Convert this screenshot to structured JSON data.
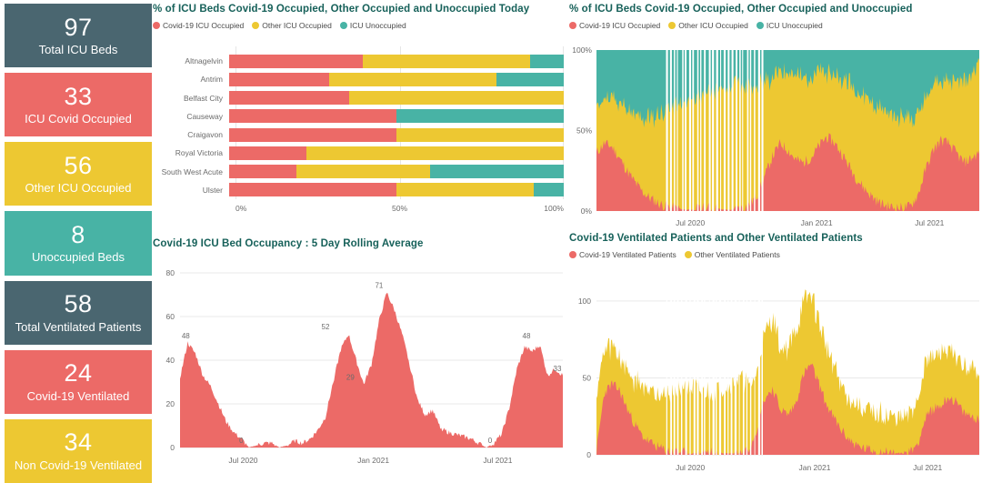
{
  "colors": {
    "covid_red": "#ec6a67",
    "other_yellow": "#edc832",
    "unoccupied_teal": "#48b3a5",
    "slate": "#4a6670",
    "title": "#17615a",
    "axis_text": "#6b6b6b",
    "grid": "#e9e9e9"
  },
  "kpis": [
    {
      "value": "97",
      "label": "Total ICU Beds",
      "color": "#4a6670"
    },
    {
      "value": "33",
      "label": "ICU Covid Occupied",
      "color": "#ec6a67"
    },
    {
      "value": "56",
      "label": "Other ICU Occupied",
      "color": "#edc832"
    },
    {
      "value": "8",
      "label": "Unoccupied Beds",
      "color": "#48b3a5"
    },
    {
      "value": "58",
      "label": "Total Ventilated Patients",
      "color": "#4a6670"
    },
    {
      "value": "24",
      "label": "Covid-19 Ventilated",
      "color": "#ec6a67"
    },
    {
      "value": "34",
      "label": "Non Covid-19 Ventilated",
      "color": "#edc832"
    }
  ],
  "panel_hospital": {
    "title": "% of ICU Beds Covid-19 Occupied, Other Occupied and Unoccupied Today",
    "legend": [
      {
        "label": "Covid-19 ICU Occupied",
        "color": "#ec6a67"
      },
      {
        "label": "Other ICU Occupied",
        "color": "#edc832"
      },
      {
        "label": "ICU Unoccupied",
        "color": "#48b3a5"
      }
    ]
  },
  "panel_pct_trend": {
    "title": "% of ICU Beds Covid-19 Occupied, Other Occupied and Unoccupied",
    "legend": [
      {
        "label": "Covid-19 ICU Occupied",
        "color": "#ec6a67"
      },
      {
        "label": "Other ICU Occupied",
        "color": "#edc832"
      },
      {
        "label": "ICU Unoccupied",
        "color": "#48b3a5"
      }
    ]
  },
  "panel_rolling": {
    "title": "Covid-19 ICU Bed Occupancy : 5 Day Rolling Average"
  },
  "panel_vent": {
    "title": "Covid-19 Ventilated Patients and Other Ventilated Patients",
    "legend": [
      {
        "label": "Covid-19 Ventilated Patients",
        "color": "#ec6a67"
      },
      {
        "label": "Other Ventilated Patients",
        "color": "#edc832"
      }
    ]
  },
  "chart_data": [
    {
      "id": "hospital_stacked",
      "type": "bar",
      "orientation": "horizontal",
      "stacked": true,
      "title": "% of ICU Beds Covid-19 Occupied, Other Occupied and Unoccupied Today",
      "xlabel": "",
      "ylabel": "",
      "xlim": [
        0,
        100
      ],
      "xticks": [
        0,
        50,
        100
      ],
      "xticklabels": [
        "0%",
        "50%",
        "100%"
      ],
      "grid": true,
      "legend_position": "top-left",
      "categories": [
        "Altnagelvin",
        "Antrim",
        "Belfast City",
        "Causeway",
        "Craigavon",
        "Royal Victoria",
        "South West Acute",
        "Ulster"
      ],
      "series": [
        {
          "name": "Covid-19 ICU Occupied",
          "color": "#ec6a67",
          "values": [
            40,
            30,
            36,
            50,
            50,
            23,
            20,
            50
          ]
        },
        {
          "name": "Other ICU Occupied",
          "color": "#edc832",
          "values": [
            50,
            50,
            64,
            0,
            50,
            77,
            40,
            41
          ]
        },
        {
          "name": "ICU Unoccupied",
          "color": "#48b3a5",
          "values": [
            10,
            20,
            0,
            50,
            0,
            0,
            40,
            9
          ]
        }
      ]
    },
    {
      "id": "pct_trend",
      "type": "area",
      "stacked": true,
      "normalized": true,
      "title": "% of ICU Beds Covid-19 Occupied, Other Occupied and Unoccupied",
      "xlabel": "",
      "ylabel": "",
      "ylim": [
        0,
        100
      ],
      "yticks": [
        0,
        50,
        100
      ],
      "yticklabels": [
        "0%",
        "50%",
        "100%"
      ],
      "xticklabels": [
        "Jul 2020",
        "Jan 2021",
        "Jul 2021"
      ],
      "xtick_positions_pct": [
        24.5,
        57.5,
        87.0
      ],
      "grid": false,
      "legend_position": "top-left",
      "series": [
        {
          "name": "Covid-19 ICU Occupied",
          "color": "#ec6a67"
        },
        {
          "name": "Other ICU Occupied",
          "color": "#edc832"
        },
        {
          "name": "ICU Unoccupied",
          "color": "#48b3a5"
        }
      ],
      "x_sample_pct": [
        0,
        2,
        4,
        6,
        8,
        10,
        12,
        14,
        16,
        18,
        20,
        22,
        24,
        26,
        28,
        30,
        32,
        34,
        36,
        38,
        40,
        42,
        44,
        46,
        48,
        50,
        52,
        54,
        56,
        58,
        60,
        62,
        64,
        66,
        68,
        70,
        72,
        74,
        76,
        78,
        80,
        82,
        84,
        86,
        88,
        90,
        92,
        94,
        96,
        98,
        100
      ],
      "covid_pct": [
        36,
        42,
        40,
        33,
        25,
        18,
        12,
        8,
        5,
        3,
        2,
        1,
        1,
        1,
        2,
        2,
        1,
        1,
        1,
        2,
        4,
        10,
        22,
        34,
        42,
        38,
        32,
        30,
        33,
        40,
        46,
        43,
        36,
        28,
        20,
        14,
        9,
        5,
        3,
        2,
        2,
        3,
        10,
        26,
        38,
        44,
        42,
        36,
        30,
        33,
        36
      ],
      "other_pct": [
        27,
        25,
        30,
        33,
        38,
        42,
        45,
        50,
        55,
        58,
        62,
        66,
        68,
        70,
        70,
        72,
        74,
        76,
        78,
        76,
        74,
        68,
        58,
        50,
        45,
        48,
        52,
        54,
        50,
        45,
        40,
        42,
        47,
        52,
        56,
        58,
        58,
        60,
        58,
        56,
        55,
        54,
        50,
        44,
        40,
        36,
        38,
        44,
        50,
        52,
        56
      ],
      "unoccupied_pct": [
        37,
        33,
        30,
        34,
        37,
        40,
        43,
        42,
        40,
        39,
        36,
        33,
        31,
        29,
        28,
        26,
        25,
        23,
        21,
        22,
        22,
        22,
        20,
        16,
        13,
        14,
        16,
        16,
        17,
        15,
        14,
        15,
        17,
        20,
        24,
        28,
        33,
        35,
        39,
        42,
        43,
        43,
        40,
        30,
        22,
        20,
        20,
        20,
        20,
        15,
        8
      ],
      "white_gap_zone_pct": [
        18,
        44
      ]
    },
    {
      "id": "icu_rolling_avg",
      "type": "area",
      "title": "Covid-19 ICU Bed Occupancy : 5 Day Rolling Average",
      "xlabel": "",
      "ylabel": "",
      "ylim": [
        0,
        80
      ],
      "yticks": [
        0,
        20,
        40,
        60,
        80
      ],
      "yticklabels": [
        "0",
        "20",
        "40",
        "60",
        "80"
      ],
      "xticklabels": [
        "Jul 2020",
        "Jan 2021",
        "Jul 2021"
      ],
      "xtick_positions_pct": [
        16.5,
        50.5,
        83.0
      ],
      "grid": true,
      "color": "#ec6a67",
      "annotations": [
        {
          "label": "48",
          "x_pct": 1.5,
          "value": 48
        },
        {
          "label": "0",
          "x_pct": 16.0,
          "value": 0
        },
        {
          "label": "52",
          "x_pct": 38.0,
          "value": 52
        },
        {
          "label": "29",
          "x_pct": 44.5,
          "value": 29
        },
        {
          "label": "71",
          "x_pct": 52.0,
          "value": 71
        },
        {
          "label": "0",
          "x_pct": 81.0,
          "value": 0
        },
        {
          "label": "48",
          "x_pct": 90.5,
          "value": 48
        },
        {
          "label": "33",
          "x_pct": 99.0,
          "value": 33
        }
      ],
      "x_sample_pct": [
        0,
        2,
        4,
        6,
        8,
        10,
        12,
        14,
        16,
        18,
        20,
        22,
        24,
        26,
        28,
        30,
        32,
        34,
        36,
        38,
        40,
        42,
        44,
        46,
        48,
        50,
        52,
        54,
        56,
        58,
        60,
        62,
        64,
        66,
        68,
        70,
        72,
        74,
        76,
        78,
        80,
        82,
        84,
        86,
        88,
        90,
        92,
        94,
        96,
        98,
        100
      ],
      "values": [
        32,
        48,
        43,
        33,
        28,
        20,
        12,
        7,
        4,
        0,
        1,
        2,
        2,
        0,
        1,
        3,
        2,
        4,
        8,
        14,
        30,
        45,
        52,
        40,
        29,
        38,
        58,
        71,
        63,
        52,
        38,
        22,
        15,
        17,
        9,
        7,
        6,
        5,
        4,
        2,
        0,
        2,
        6,
        18,
        36,
        46,
        44,
        47,
        33,
        36,
        33
      ]
    },
    {
      "id": "ventilated",
      "type": "area",
      "stacked": true,
      "title": "Covid-19 Ventilated Patients and Other Ventilated Patients",
      "xlabel": "",
      "ylabel": "",
      "ylim": [
        0,
        110
      ],
      "yticks": [
        0,
        50,
        100
      ],
      "yticklabels": [
        "0",
        "50",
        "100"
      ],
      "xticklabels": [
        "Jul 2020",
        "Jan 2021",
        "Jul 2021"
      ],
      "xtick_positions_pct": [
        24.5,
        57.0,
        86.5
      ],
      "grid": true,
      "legend_position": "top-left",
      "series": [
        {
          "name": "Covid-19 Ventilated Patients",
          "color": "#ec6a67"
        },
        {
          "name": "Other Ventilated Patients",
          "color": "#edc832"
        }
      ],
      "x_sample_pct": [
        0,
        2,
        4,
        6,
        8,
        10,
        12,
        14,
        16,
        18,
        20,
        22,
        24,
        26,
        28,
        30,
        32,
        34,
        36,
        38,
        40,
        42,
        44,
        46,
        48,
        50,
        52,
        54,
        56,
        58,
        60,
        62,
        64,
        66,
        68,
        70,
        72,
        74,
        76,
        78,
        80,
        82,
        84,
        86,
        88,
        90,
        92,
        94,
        96,
        98,
        100
      ],
      "covid_values": [
        2,
        40,
        46,
        42,
        30,
        20,
        12,
        8,
        5,
        3,
        2,
        2,
        1,
        1,
        2,
        2,
        1,
        1,
        1,
        2,
        5,
        18,
        37,
        43,
        30,
        26,
        33,
        52,
        59,
        47,
        33,
        24,
        16,
        10,
        6,
        4,
        3,
        2,
        2,
        1,
        1,
        2,
        8,
        24,
        30,
        32,
        38,
        34,
        27,
        25,
        23
      ],
      "other_values": [
        36,
        28,
        24,
        22,
        25,
        28,
        33,
        34,
        36,
        37,
        40,
        41,
        42,
        43,
        38,
        40,
        42,
        43,
        46,
        48,
        40,
        38,
        42,
        47,
        40,
        42,
        48,
        46,
        45,
        40,
        38,
        34,
        28,
        27,
        26,
        24,
        24,
        25,
        22,
        23,
        22,
        24,
        30,
        38,
        32,
        36,
        30,
        28,
        29,
        30,
        33
      ],
      "white_gap_zone_pct": [
        18,
        44
      ]
    }
  ]
}
